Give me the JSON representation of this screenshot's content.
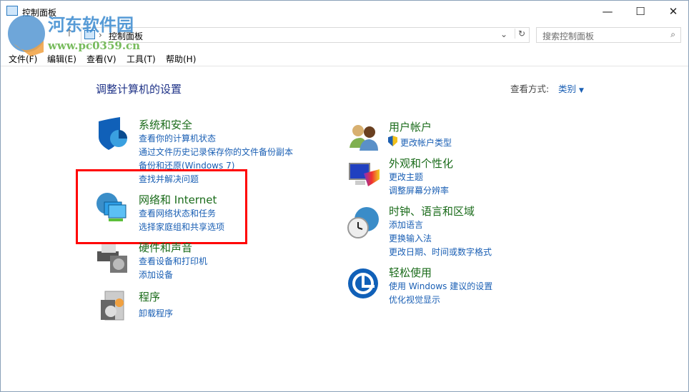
{
  "window": {
    "title": "控制面板",
    "controls": [
      "minimize",
      "maximize",
      "close"
    ]
  },
  "address": {
    "path": "控制面板",
    "separator": "›"
  },
  "search": {
    "placeholder": "搜索控制面板"
  },
  "menu": [
    "文件(F)",
    "编辑(E)",
    "查看(V)",
    "工具(T)",
    "帮助(H)"
  ],
  "main": {
    "heading": "调整计算机的设置",
    "view_by_label": "查看方式:",
    "view_by_value": "类别",
    "left": [
      {
        "title": "系统和安全",
        "icon": "shield-icon",
        "links": [
          "查看你的计算机状态",
          "通过文件历史记录保存你的文件备份副本",
          "备份和还原(Windows 7)",
          "查找并解决问题"
        ]
      },
      {
        "title": "网络和 Internet",
        "icon": "network-icon",
        "links": [
          "查看网络状态和任务",
          "选择家庭组和共享选项"
        ]
      },
      {
        "title": "硬件和声音",
        "icon": "printer-icon",
        "links": [
          "查看设备和打印机",
          "添加设备"
        ]
      },
      {
        "title": "程序",
        "icon": "programs-icon",
        "links": [
          "卸载程序"
        ]
      }
    ],
    "right": [
      {
        "title": "用户帐户",
        "icon": "users-icon",
        "links": [
          "更改帐户类型"
        ]
      },
      {
        "title": "外观和个性化",
        "icon": "appearance-icon",
        "links": [
          "更改主题",
          "调整屏幕分辨率"
        ]
      },
      {
        "title": "时钟、语言和区域",
        "icon": "clock-globe-icon",
        "links": [
          "添加语言",
          "更换输入法",
          "更改日期、时间或数字格式"
        ]
      },
      {
        "title": "轻松使用",
        "icon": "ease-of-access-icon",
        "links": [
          "使用 Windows 建议的设置",
          "优化视觉显示"
        ]
      }
    ]
  },
  "watermark": {
    "name": "河东软件园",
    "url": "www.pc0359.cn"
  },
  "colors": {
    "title_green": "#1a6b1a",
    "link_blue": "#1a5fb4",
    "highlight": "#ff0000"
  }
}
